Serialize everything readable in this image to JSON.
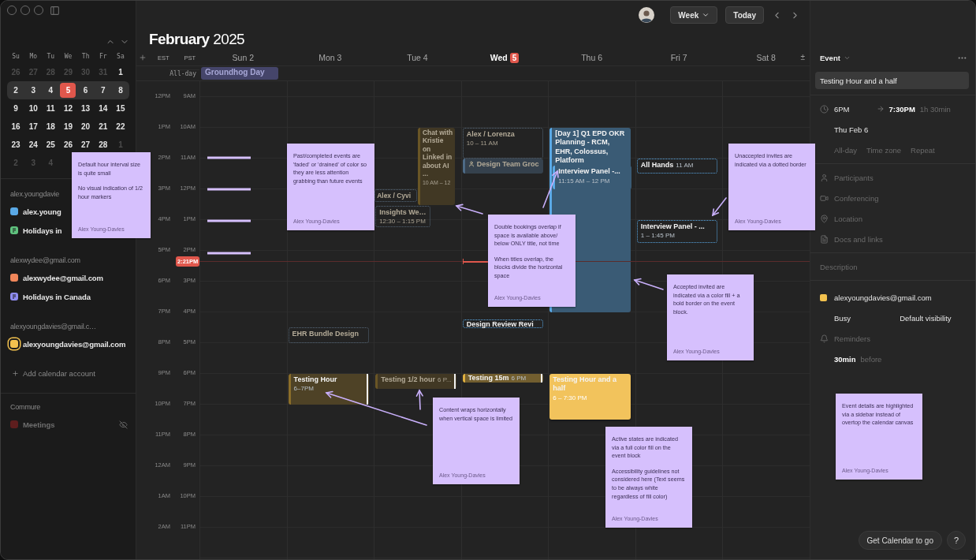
{
  "sidebar": {
    "mini_calendar": {
      "weekdays": [
        "Su",
        "Mo",
        "Tu",
        "We",
        "Th",
        "Fr",
        "Sa"
      ],
      "weeks": [
        {
          "selected": false,
          "days": [
            {
              "label": "26",
              "muted": true,
              "today": false
            },
            {
              "label": "27",
              "muted": true,
              "today": false
            },
            {
              "label": "28",
              "muted": true,
              "today": false
            },
            {
              "label": "29",
              "muted": true,
              "today": false
            },
            {
              "label": "30",
              "muted": true,
              "today": false
            },
            {
              "label": "31",
              "muted": true,
              "today": false
            },
            {
              "label": "1",
              "muted": false,
              "today": false
            }
          ]
        },
        {
          "selected": true,
          "days": [
            {
              "label": "2",
              "muted": false,
              "today": false
            },
            {
              "label": "3",
              "muted": false,
              "today": false
            },
            {
              "label": "4",
              "muted": false,
              "today": false
            },
            {
              "label": "5",
              "muted": false,
              "today": true
            },
            {
              "label": "6",
              "muted": false,
              "today": false
            },
            {
              "label": "7",
              "muted": false,
              "today": false
            },
            {
              "label": "8",
              "muted": false,
              "today": false
            }
          ]
        },
        {
          "selected": false,
          "days": [
            {
              "label": "9",
              "muted": false,
              "today": false
            },
            {
              "label": "10",
              "muted": false,
              "today": false
            },
            {
              "label": "11",
              "muted": false,
              "today": false
            },
            {
              "label": "12",
              "muted": false,
              "today": false
            },
            {
              "label": "13",
              "muted": false,
              "today": false
            },
            {
              "label": "14",
              "muted": false,
              "today": false
            },
            {
              "label": "15",
              "muted": false,
              "today": false
            }
          ]
        },
        {
          "selected": false,
          "days": [
            {
              "label": "16",
              "muted": false,
              "today": false
            },
            {
              "label": "17",
              "muted": false,
              "today": false
            },
            {
              "label": "18",
              "muted": false,
              "today": false
            },
            {
              "label": "19",
              "muted": false,
              "today": false
            },
            {
              "label": "20",
              "muted": false,
              "today": false
            },
            {
              "label": "21",
              "muted": false,
              "today": false
            },
            {
              "label": "22",
              "muted": false,
              "today": false
            }
          ]
        },
        {
          "selected": false,
          "days": [
            {
              "label": "23",
              "muted": false,
              "today": false
            },
            {
              "label": "24",
              "muted": false,
              "today": false
            },
            {
              "label": "25",
              "muted": false,
              "today": false
            },
            {
              "label": "26",
              "muted": false,
              "today": false
            },
            {
              "label": "27",
              "muted": false,
              "today": false
            },
            {
              "label": "28",
              "muted": false,
              "today": false
            },
            {
              "label": "1",
              "muted": true,
              "today": false
            }
          ]
        },
        {
          "selected": false,
          "days": [
            {
              "label": "2",
              "muted": true,
              "today": false
            },
            {
              "label": "3",
              "muted": true,
              "today": false
            },
            {
              "label": "4",
              "muted": true,
              "today": false
            }
          ]
        }
      ]
    },
    "groups": [
      {
        "header": "alex.youngdavie",
        "calendars": [
          {
            "name": "alex.young",
            "kind": "square",
            "color": "#5aa9e6",
            "selected": false,
            "hidden": false
          },
          {
            "name": "Holidays in",
            "kind": "holiday",
            "color": "#5fc27e",
            "selected": false,
            "hidden": false
          }
        ]
      },
      {
        "header": "alexwydee@gmail.com",
        "calendars": [
          {
            "name": "alexwydee@gmail.com",
            "kind": "square",
            "color": "#f0865a",
            "selected": false,
            "hidden": false
          },
          {
            "name": "Holidays in Canada",
            "kind": "holiday",
            "color": "#8f8cf0",
            "selected": false,
            "hidden": false
          }
        ]
      },
      {
        "header": "alexyoungdavies@gmail.c…",
        "calendars": [
          {
            "name": "alexyoungdavies@gmail.com",
            "kind": "square",
            "color": "#f2c14e",
            "selected": true,
            "hidden": false
          }
        ]
      }
    ],
    "add_account": "Add calendar account",
    "other_groups": [
      {
        "header": "Commure",
        "calendars": [
          {
            "name": "Meetings",
            "kind": "square",
            "color": "#5e1e1e",
            "selected": false,
            "hidden": true
          }
        ]
      }
    ]
  },
  "toolbar": {
    "view": "Week",
    "today": "Today"
  },
  "calendar": {
    "title": "**February** 2025",
    "timezones": [
      "EST",
      "PST"
    ],
    "zoom": "±",
    "all_day_label": "All-day",
    "hours": [
      {
        "est": "12PM",
        "pst": "9AM"
      },
      {
        "est": "1PM",
        "pst": "10AM"
      },
      {
        "est": "2PM",
        "pst": "11AM"
      },
      {
        "est": "3PM",
        "pst": "12PM"
      },
      {
        "est": "4PM",
        "pst": "1PM"
      },
      {
        "est": "5PM",
        "pst": "2PM"
      },
      {
        "est": "6PM",
        "pst": "3PM"
      },
      {
        "est": "7PM",
        "pst": "4PM"
      },
      {
        "est": "8PM",
        "pst": "5PM"
      },
      {
        "est": "9PM",
        "pst": "6PM"
      },
      {
        "est": "10PM",
        "pst": "7PM"
      },
      {
        "est": "11PM",
        "pst": "8PM"
      },
      {
        "est": "12AM",
        "pst": "9PM"
      },
      {
        "est": "1AM",
        "pst": "10PM"
      },
      {
        "est": "2AM",
        "pst": "11PM"
      }
    ],
    "now": {
      "label": "2:21PM"
    },
    "days": [
      {
        "weekday": "Sun",
        "date": "2",
        "today": false,
        "all_day": [
          {
            "title": "Groundhog Day"
          }
        ]
      },
      {
        "weekday": "Mon",
        "date": "3",
        "today": false,
        "events": [
          {
            "title": "EHR Bundle Design",
            "kind": "unaccepted",
            "past": true,
            "color": "#56687a"
          },
          {
            "title": "Testing Hour",
            "time": "6–7PM",
            "kind": "accepted",
            "past": false,
            "color": "#8a6d2a"
          }
        ]
      },
      {
        "weekday": "Tue",
        "date": "4",
        "today": false,
        "events": [
          {
            "title": "Alex / Cyvi",
            "kind": "unaccepted",
            "past": true,
            "color": "#56687a"
          },
          {
            "title": "Insights We…",
            "time": "12:30 – 1:15 PM",
            "kind": "unaccepted",
            "past": true,
            "color": "#56687a"
          },
          {
            "title": "Chat with Kristie on Linked in about AI ...",
            "time": "10 AM – 12",
            "kind": "accepted",
            "past": true,
            "color": "#6a5626"
          },
          {
            "title": "Testing 1/2 hour",
            "time": "6 P...",
            "kind": "accepted",
            "past": true,
            "color": "#6a5626"
          }
        ]
      },
      {
        "weekday": "Wed",
        "date": "5",
        "today": true,
        "events": [
          {
            "title": "Alex / Lorenza",
            "time": "10 – 11 AM",
            "kind": "unaccepted",
            "past": true,
            "color": "#56687a"
          },
          {
            "title": "Design Team Groc",
            "kind": "accepted",
            "past": true,
            "color": "#4d6a86"
          },
          {
            "title": "Design Review Revi",
            "kind": "unaccepted",
            "past": false,
            "color": "#5aa9e6"
          },
          {
            "title": "Testing 15m",
            "time": "6 PM",
            "kind": "accepted",
            "past": false,
            "color": "#e0b040"
          }
        ]
      },
      {
        "weekday": "Thu",
        "date": "6",
        "today": false,
        "events": [
          {
            "title": "[Day 1] Q1 EPD OKR Planning - RCM, EHR, Colossus, Platform",
            "kind": "accepted",
            "past": false,
            "color": "#5aa9e6"
          },
          {
            "title": "Interview Panel -...",
            "time": "11:15 AM – 12 PM",
            "kind": "accepted",
            "past": false,
            "color": "#5aa9e6"
          },
          {
            "title": "Testing Hour and a half",
            "time": "6 – 7:30 PM",
            "kind": "active",
            "past": false,
            "color": "#f2c35c"
          }
        ]
      },
      {
        "weekday": "Fri",
        "date": "7",
        "today": false,
        "events": [
          {
            "title": "All Hands",
            "time": "11 AM",
            "kind": "unaccepted",
            "past": false,
            "color": "#5aa9e6"
          },
          {
            "title": "Interview Panel - ...",
            "time": "1 – 1:45 PM",
            "kind": "unaccepted",
            "past": false,
            "color": "#5aa9e6"
          }
        ]
      },
      {
        "weekday": "Sat",
        "date": "8",
        "today": false
      }
    ]
  },
  "notes": [
    {
      "paragraphs": [
        "Default hour interval size is quite small",
        "No visual indication of 1/2 hour markers"
      ],
      "author": "Alex Young-Davies"
    },
    {
      "paragraphs": [
        "Past/completed events are 'faded' or 'drained' of color so they are less attention grabbing than future events"
      ],
      "author": "Alex Young-Davies"
    },
    {
      "paragraphs": [
        "Double bookings overlap if space is available above/ below ONLY title, not time",
        "When titles overlap, the blocks divide the horizontal space"
      ],
      "author": "Alex Young-Davies"
    },
    {
      "paragraphs": [
        "Unaccepted invites are indicated via a dotted border"
      ],
      "author": "Alex Young-Davies"
    },
    {
      "paragraphs": [
        "Accepted invited are indicated via a color fill + a bold border on the event block."
      ],
      "author": "Alex Young-Davies"
    },
    {
      "paragraphs": [
        "Content wraps horizontally when vertical space is limited"
      ],
      "author": "Alex Young-Davies"
    },
    {
      "paragraphs": [
        "Active states are indicated via a full color fill on the event block",
        "Accessibility guidelines not considered here (Text seems to be always white regardless of fill color)"
      ],
      "author": "Alex Young-Davies"
    },
    {
      "paragraphs": [
        "Event details are highlighted via a sidebar instead of overtop the calendar canvas"
      ],
      "author": "Alex Young-Davies"
    }
  ],
  "event_panel": {
    "heading": "Event",
    "title": "Testing Hour and a half",
    "start": "6PM",
    "end": "7:30PM",
    "duration": "1h 30min",
    "date": "Thu Feb 6",
    "options": [
      "All-day",
      "Time zone",
      "Repeat"
    ],
    "fields": [
      {
        "kind": "participants",
        "label": "Participants"
      },
      {
        "kind": "conferencing",
        "label": "Conferencing"
      },
      {
        "kind": "location",
        "label": "Location"
      },
      {
        "kind": "docs",
        "label": "Docs and links"
      }
    ],
    "description_placeholder": "Description",
    "calendar": {
      "name": "alexyoungdavies@gmail.com",
      "color": "#f2c14e"
    },
    "availability": "Busy",
    "visibility": "Default visibility",
    "reminders_label": "Reminders",
    "reminder_amount": "30min",
    "reminder_suffix": "before"
  },
  "footer": {
    "promo": "Get Calendar to go",
    "help": "?"
  }
}
